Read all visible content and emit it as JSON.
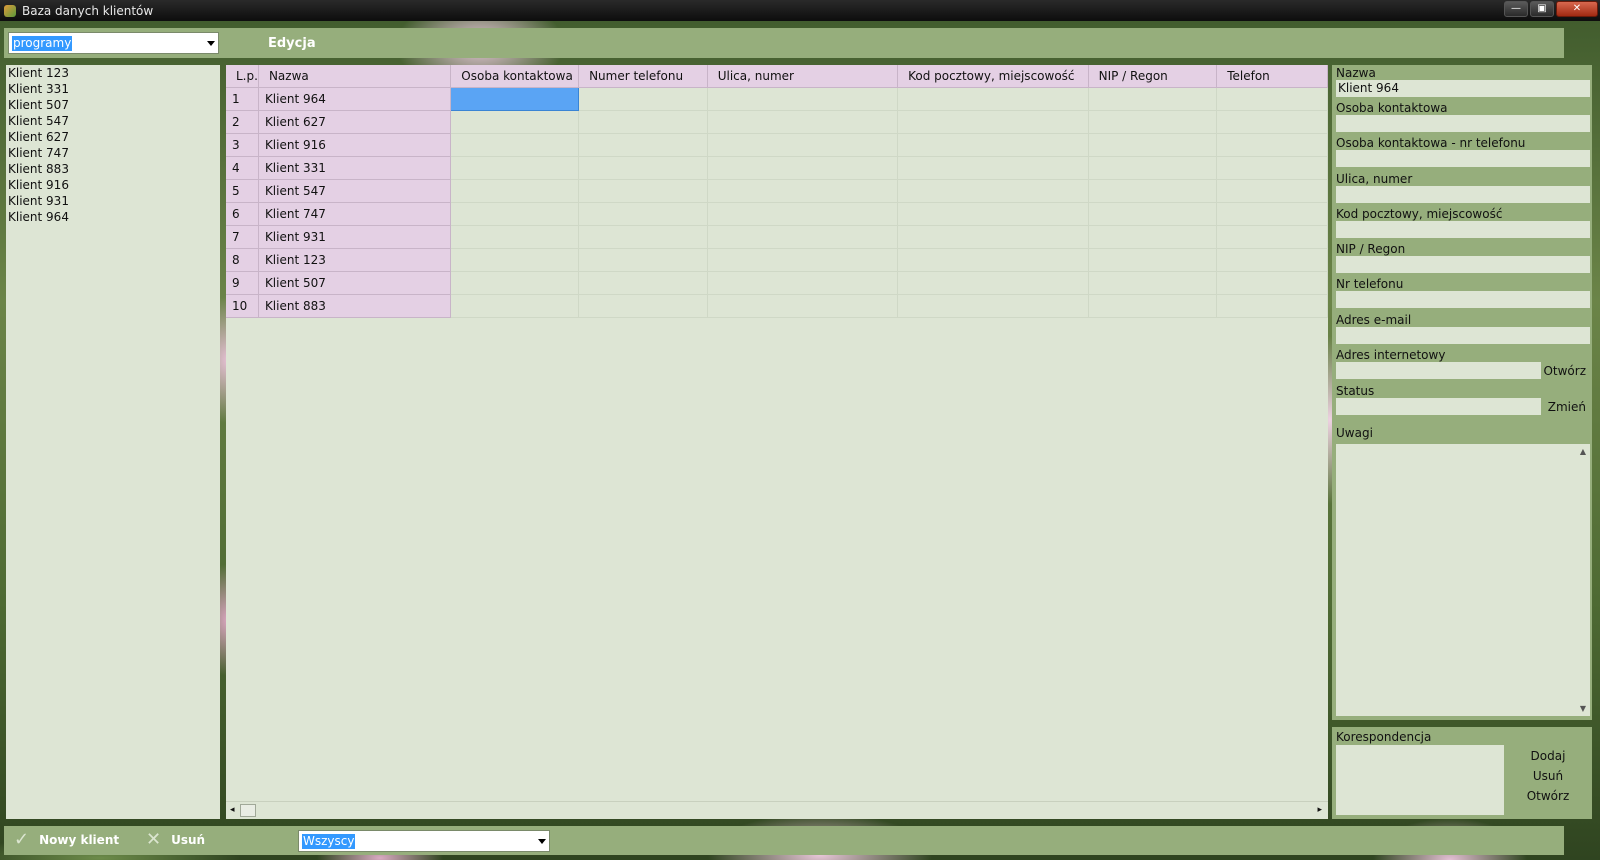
{
  "window": {
    "title": "Baza danych klientów",
    "controls": [
      "—",
      "▣",
      "✕"
    ]
  },
  "toolbar": {
    "filter_combo": "programy",
    "edit_menu": "Edycja"
  },
  "client_list": [
    "Klient 123",
    "Klient 331",
    "Klient 507",
    "Klient 547",
    "Klient 627",
    "Klient 747",
    "Klient 883",
    "Klient 916",
    "Klient 931",
    "Klient 964"
  ],
  "grid": {
    "columns": [
      "L.p.",
      "Nazwa",
      "Osoba kontaktowa",
      "Numer telefonu",
      "Ulica, numer",
      "Kod pocztowy, miejscowość",
      "NIP / Regon",
      "Telefon"
    ],
    "rows": [
      {
        "lp": "1",
        "name": "Klient 964"
      },
      {
        "lp": "2",
        "name": "Klient 627"
      },
      {
        "lp": "3",
        "name": "Klient 916"
      },
      {
        "lp": "4",
        "name": "Klient 331"
      },
      {
        "lp": "5",
        "name": "Klient 547"
      },
      {
        "lp": "6",
        "name": "Klient 747"
      },
      {
        "lp": "7",
        "name": "Klient 931"
      },
      {
        "lp": "8",
        "name": "Klient 123"
      },
      {
        "lp": "9",
        "name": "Klient 507"
      },
      {
        "lp": "10",
        "name": "Klient 883"
      }
    ],
    "scroll_left": "◂",
    "scroll_right": "▸"
  },
  "detail": {
    "fields": [
      {
        "label": "Nazwa",
        "value": "Klient 964"
      },
      {
        "label": "Osoba kontaktowa",
        "value": ""
      },
      {
        "label": "Osoba kontaktowa - nr telefonu",
        "value": ""
      },
      {
        "label": "Ulica, numer",
        "value": ""
      },
      {
        "label": "Kod pocztowy, miejscowość",
        "value": ""
      },
      {
        "label": "NIP / Regon",
        "value": ""
      },
      {
        "label": "Nr telefonu",
        "value": ""
      },
      {
        "label": "Adres e-mail",
        "value": ""
      },
      {
        "label": "Adres internetowy",
        "value": "",
        "button": "Otwórz"
      },
      {
        "label": "Status",
        "value": "",
        "button": "Zmień"
      }
    ],
    "notes_label": "Uwagi",
    "notes_scroll_up": "▲",
    "notes_scroll_down": "▼"
  },
  "correspondence": {
    "label": "Korespondencja",
    "buttons": [
      "Dodaj",
      "Usuń",
      "Otwórz"
    ]
  },
  "bottom": {
    "new_client_icon": "check-icon",
    "new_client_glyph": "✓",
    "new_client_label": "Nowy klient",
    "delete_icon": "cross-icon",
    "delete_glyph": "✕",
    "delete_label": "Usuń",
    "status_combo": "Wszyscy"
  }
}
